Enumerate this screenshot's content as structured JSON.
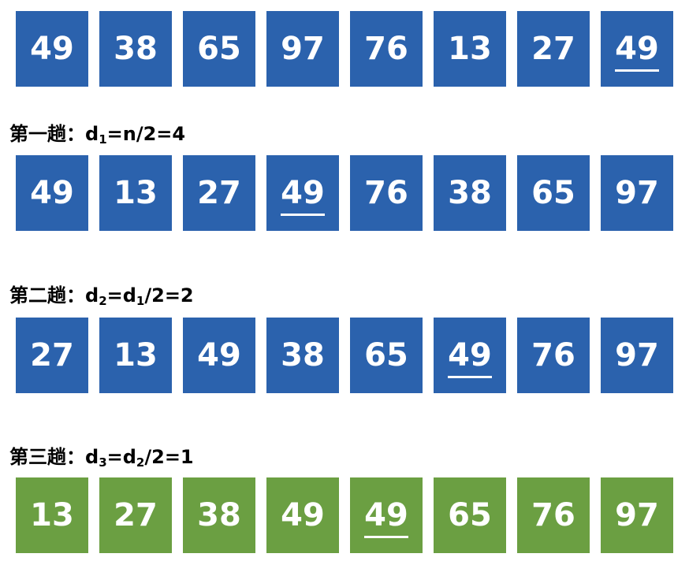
{
  "colors": {
    "pending_box": "#2b62ad",
    "sorted_box": "#6b9f42",
    "text_on_box": "#ffffff"
  },
  "rows": [
    {
      "label": null,
      "style": "pending",
      "values": [
        "49",
        "38",
        "65",
        "97",
        "76",
        "13",
        "27",
        "49"
      ],
      "underlined_index": 7
    },
    {
      "label": {
        "prefix": "第一趟：",
        "parts": [
          [
            "d",
            "1"
          ],
          [
            "=n/2=4",
            ""
          ]
        ]
      },
      "style": "pending",
      "values": [
        "49",
        "13",
        "27",
        "49",
        "76",
        "38",
        "65",
        "97"
      ],
      "underlined_index": 3
    },
    {
      "label": {
        "prefix": "第二趟：",
        "parts": [
          [
            "d",
            "2"
          ],
          [
            "=d",
            "1"
          ],
          [
            "/2=2",
            ""
          ]
        ]
      },
      "style": "pending",
      "values": [
        "27",
        "13",
        "49",
        "38",
        "65",
        "49",
        "76",
        "97"
      ],
      "underlined_index": 5
    },
    {
      "label": {
        "prefix": "第三趟：",
        "parts": [
          [
            "d",
            "3"
          ],
          [
            "=d",
            "2"
          ],
          [
            "/2=1",
            ""
          ]
        ]
      },
      "style": "sorted",
      "values": [
        "13",
        "27",
        "38",
        "49",
        "49",
        "65",
        "76",
        "97"
      ],
      "underlined_index": 4
    }
  ]
}
